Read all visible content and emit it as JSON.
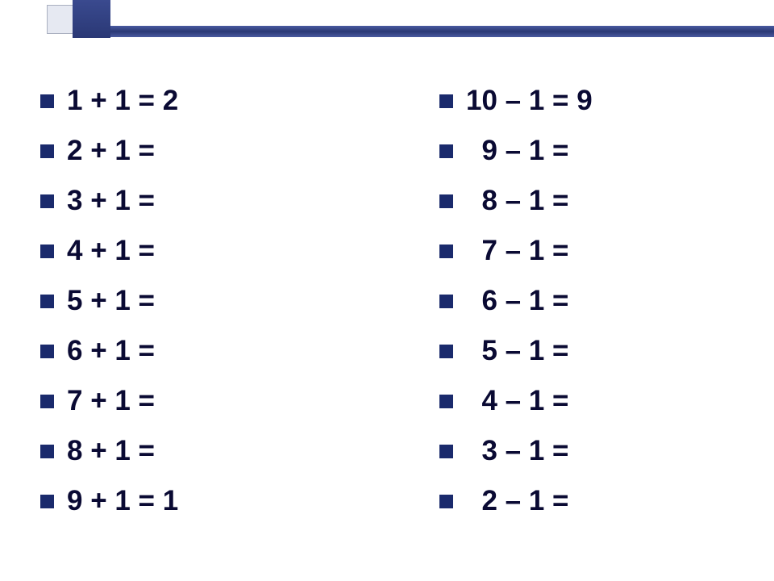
{
  "left_column": [
    "1 + 1 = 2",
    "2 + 1 = ",
    "3 + 1 = ",
    "4 + 1 = ",
    "5 + 1 = ",
    "6 + 1 = ",
    "7 + 1 = ",
    "8 + 1 = ",
    "9 + 1 = 1"
  ],
  "right_column": [
    "10 – 1 = 9",
    "  9 – 1 = ",
    "  8 – 1 = ",
    "  7 – 1 = ",
    "  6 – 1 = ",
    "  5 – 1 = ",
    "  4 – 1 = ",
    "  3 – 1 = ",
    "  2 – 1 = "
  ]
}
